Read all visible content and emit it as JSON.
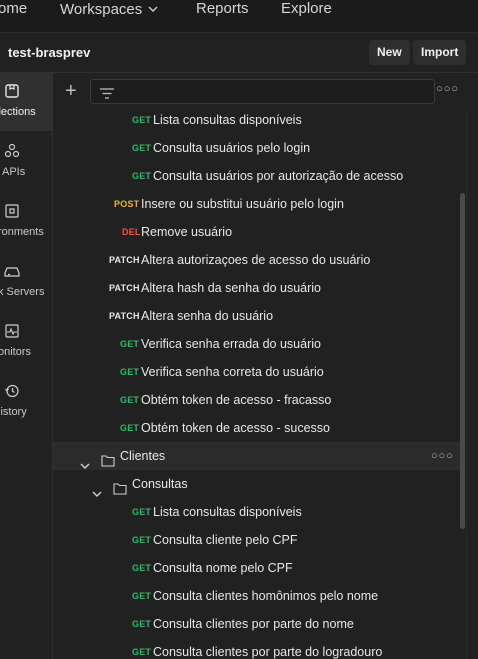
{
  "topnav": {
    "home": "ome",
    "workspaces": "Workspaces",
    "reports": "Reports",
    "explore": "Explore"
  },
  "workspace": {
    "title": "test-brasprev",
    "new_label": "New",
    "import_label": "Import"
  },
  "rail": [
    {
      "label": "llections",
      "icon": "collections-icon",
      "active": true
    },
    {
      "label": "APIs",
      "icon": "apis-icon"
    },
    {
      "label": "ronments",
      "icon": "environments-icon"
    },
    {
      "label": "k Servers",
      "icon": "mock-servers-icon"
    },
    {
      "label": "onitors",
      "icon": "monitors-icon"
    },
    {
      "label": "listory",
      "icon": "history-icon"
    }
  ],
  "tree": [
    {
      "method": "GET",
      "name": "Lista consultas disponíveis",
      "indent": 3
    },
    {
      "method": "GET",
      "name": "Consulta usuários pelo login",
      "indent": 3
    },
    {
      "method": "GET",
      "name": "Consulta usuários por autorização de acesso",
      "indent": 3
    },
    {
      "method": "POST",
      "name": "Insere ou substitui usuário pelo login",
      "indent": 2
    },
    {
      "method": "DEL",
      "name": "Remove usuário",
      "indent": 2
    },
    {
      "method": "PATCH",
      "name": "Altera autorizaçoes de acesso do usuário",
      "indent": 2
    },
    {
      "method": "PATCH",
      "name": "Altera hash da senha do usuário",
      "indent": 2
    },
    {
      "method": "PATCH",
      "name": "Altera senha do usuário",
      "indent": 2
    },
    {
      "method": "GET",
      "name": "Verifica senha errada do usuário",
      "indent": 2
    },
    {
      "method": "GET",
      "name": "Verifica senha correta do usuário",
      "indent": 2
    },
    {
      "method": "GET",
      "name": "Obtém token de acesso - fracasso",
      "indent": 2
    },
    {
      "method": "GET",
      "name": "Obtém token de acesso - sucesso",
      "indent": 2
    },
    {
      "folder": true,
      "name": "Clientes",
      "indent": 1,
      "highlight": true
    },
    {
      "folder": true,
      "name": "Consultas",
      "indent": 2
    },
    {
      "method": "GET",
      "name": "Lista consultas disponíveis",
      "indent": 3
    },
    {
      "method": "GET",
      "name": "Consulta cliente pelo CPF",
      "indent": 3
    },
    {
      "method": "GET",
      "name": "Consulta nome pelo CPF",
      "indent": 3
    },
    {
      "method": "GET",
      "name": "Consulta clientes homônimos pelo nome",
      "indent": 3
    },
    {
      "method": "GET",
      "name": "Consulta clientes por parte do nome",
      "indent": 3
    },
    {
      "method": "GET",
      "name": "Consulta clientes por parte do logradouro",
      "indent": 3
    }
  ],
  "colors": {
    "get": "#2dbd6a",
    "post": "#e8b339",
    "delete": "#f05252",
    "background": "#212121"
  }
}
